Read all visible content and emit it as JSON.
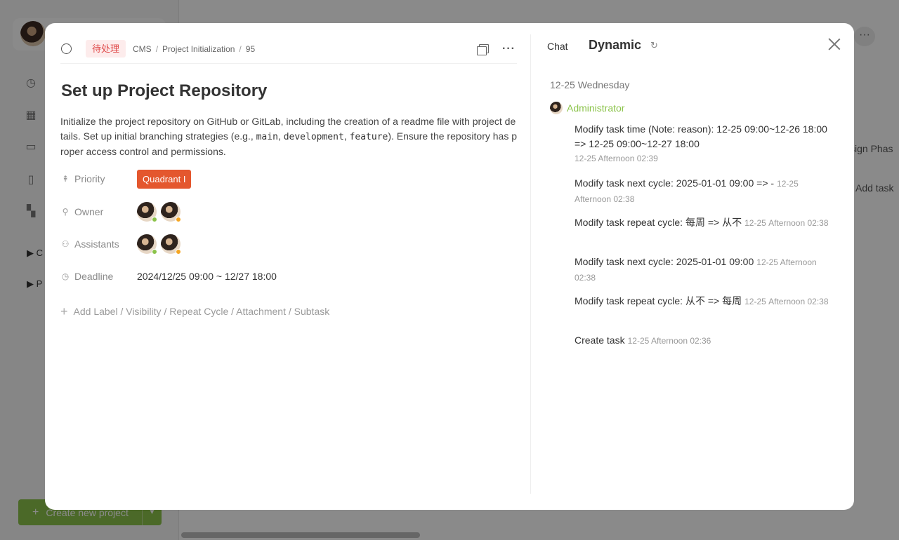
{
  "background": {
    "tree_items": [
      "C",
      "P"
    ],
    "create_button": "Create new project",
    "right_snippets": [
      "sign Phas",
      "Add task"
    ]
  },
  "header": {
    "status": "待处理",
    "breadcrumb": [
      "CMS",
      "Project Initialization",
      "95"
    ]
  },
  "task": {
    "title": "Set up Project Repository",
    "description_parts": {
      "p1": "Initialize the project repository on GitHub or GitLab, including the creation of a readme file with project details. Set up initial branching strategies (e.g., ",
      "c1": "main",
      "s1": ", ",
      "c2": "development",
      "s2": ", ",
      "c3": "feature",
      "p2": "). Ensure the repository has proper access control and permissions."
    }
  },
  "fields": {
    "priority_label": "Priority",
    "priority_value": "Quadrant I",
    "owner_label": "Owner",
    "assistants_label": "Assistants",
    "deadline_label": "Deadline",
    "deadline_value": "2024/12/25 09:00 ~ 12/27 18:00",
    "add_more": "Add Label / Visibility / Repeat Cycle / Attachment / Subtask"
  },
  "colors": {
    "status_online": "#8bc34a",
    "status_away": "#f5a623",
    "priority_bg": "#e4572e",
    "actor_name": "#8bc34a"
  },
  "activity": {
    "tab_chat": "Chat",
    "tab_dynamic": "Dynamic",
    "date_heading": "12-25 Wednesday",
    "actor": "Administrator",
    "items": [
      {
        "text": "Modify task time (Note: reason): 12-25 09:00~12-26 18:00 => 12-25 09:00~12-27 18:00",
        "time": "12-25 Afternoon 02:39"
      },
      {
        "text": "Modify task next cycle: 2025-01-01 09:00 => -",
        "time": "12-25 Afternoon 02:38"
      },
      {
        "text": "Modify task repeat cycle: 每周 => 从不",
        "time": "12-25 Afternoon 02:38"
      },
      {
        "text": "Modify task next cycle: 2025-01-01 09:00",
        "time": "12-25 Afternoon 02:38"
      },
      {
        "text": "Modify task repeat cycle: 从不 => 每周",
        "time": "12-25 Afternoon 02:38"
      },
      {
        "text": "Create task",
        "time": "12-25 Afternoon 02:36"
      }
    ]
  }
}
